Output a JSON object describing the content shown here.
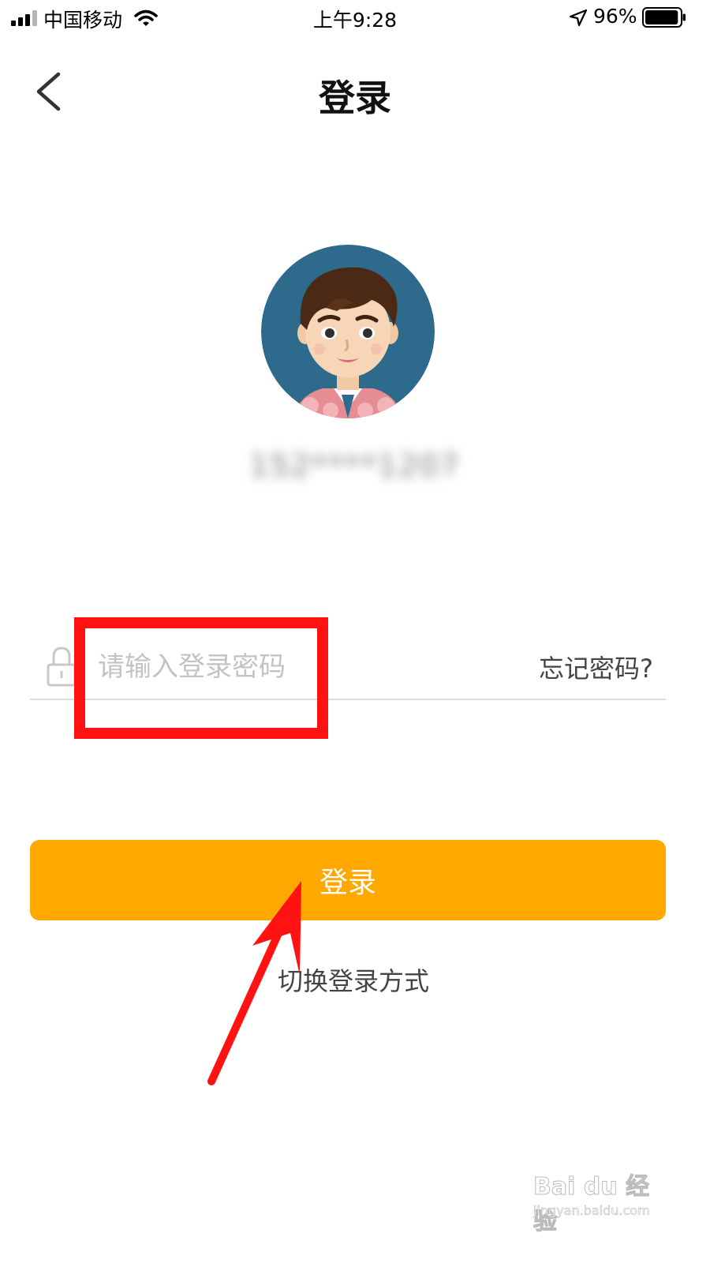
{
  "status_bar": {
    "carrier": "中国移动",
    "time": "上午9:28",
    "battery_percent": "96%",
    "battery_level": 0.96
  },
  "header": {
    "title": "登录",
    "back_icon": "chevron-left-icon"
  },
  "profile": {
    "account": "152****1207",
    "avatar_icon": "user-avatar"
  },
  "password": {
    "placeholder": "请输入登录密码",
    "value": "",
    "lock_icon": "lock-icon",
    "forgot_label": "忘记密码?"
  },
  "actions": {
    "login_label": "登录",
    "switch_label": "切换登录方式"
  },
  "colors": {
    "accent": "#ffa800",
    "annotation": "#ff1212"
  },
  "watermark": {
    "logo": "Bai du 经验",
    "url": "jingyan.baidu.com"
  }
}
